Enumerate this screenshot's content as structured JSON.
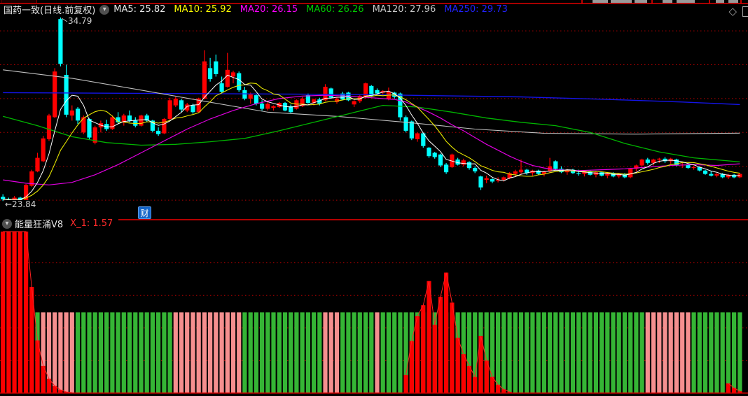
{
  "header": {
    "title": "国药一致(日线.前复权)",
    "ma_values": [
      {
        "name": "MA5",
        "label": "MA5: 25.82",
        "color": "#e8e8e8"
      },
      {
        "name": "MA10",
        "label": "MA10: 25.92",
        "color": "#ffff00"
      },
      {
        "name": "MA20",
        "label": "MA20: 26.15",
        "color": "#ff00ff"
      },
      {
        "name": "MA60",
        "label": "MA60: 26.26",
        "color": "#00c800"
      },
      {
        "name": "MA120",
        "label": "MA120: 27.96",
        "color": "#c8c8c8"
      },
      {
        "name": "MA250",
        "label": "MA250: 29.73",
        "color": "#2222ff"
      }
    ]
  },
  "price_panel": {
    "high_label": "34.79",
    "low_label": "←23.84",
    "event_marker": "财"
  },
  "indicator_panel": {
    "title": "能量狂涌V8",
    "value_label": "X_1: 1.57"
  },
  "colors": {
    "up": "#ff0000",
    "down": "#00ffff",
    "band_green": "#35b535",
    "band_pink": "#f58f8f",
    "bar_red": "#fa0000",
    "grid": "#b40000",
    "baseline": "#d40000",
    "ma5": "#ffffff",
    "ma10": "#e6e600",
    "ma20": "#e000e0",
    "ma60": "#00b400",
    "ma120": "#c0c0c0",
    "ma250": "#1414e6"
  },
  "chart_data": [
    {
      "type": "candlestick",
      "title": "国药一致 daily (front-adjusted)",
      "ylim": [
        23.3,
        35.1
      ],
      "grid_prices": [
        24,
        26,
        28,
        30,
        32,
        34
      ],
      "high_annotation": 34.79,
      "low_annotation": 23.84,
      "ohlc": [
        [
          24.2,
          24.35,
          23.95,
          24.05
        ],
        [
          24.05,
          24.15,
          23.84,
          23.95
        ],
        [
          23.95,
          24.25,
          23.88,
          24.15
        ],
        [
          24.15,
          24.2,
          23.85,
          23.95
        ],
        [
          23.95,
          24.95,
          23.9,
          24.9
        ],
        [
          24.85,
          25.8,
          24.8,
          25.7
        ],
        [
          25.7,
          26.8,
          25.65,
          26.5
        ],
        [
          26.3,
          27.8,
          26.25,
          27.65
        ],
        [
          27.6,
          29.1,
          27.5,
          29.0
        ],
        [
          28.9,
          31.8,
          28.85,
          31.6
        ],
        [
          34.7,
          34.79,
          31.9,
          32.05
        ],
        [
          31.4,
          32.0,
          28.9,
          29.05
        ],
        [
          29.0,
          29.6,
          28.7,
          29.3
        ],
        [
          29.4,
          29.5,
          28.5,
          28.7
        ],
        [
          28.0,
          29.0,
          27.9,
          28.9
        ],
        [
          28.8,
          28.85,
          27.6,
          27.7
        ],
        [
          27.4,
          28.4,
          27.3,
          28.3
        ],
        [
          28.3,
          28.7,
          28.0,
          28.55
        ],
        [
          28.5,
          28.75,
          28.1,
          28.2
        ],
        [
          28.2,
          29.0,
          28.15,
          28.9
        ],
        [
          28.9,
          29.2,
          28.5,
          28.6
        ],
        [
          28.6,
          29.1,
          28.4,
          29.0
        ],
        [
          29.0,
          29.3,
          28.6,
          28.7
        ],
        [
          28.7,
          28.9,
          28.3,
          28.4
        ],
        [
          28.4,
          29.05,
          28.35,
          29.0
        ],
        [
          29.0,
          29.1,
          28.6,
          28.7
        ],
        [
          28.7,
          28.75,
          28.0,
          28.1
        ],
        [
          28.1,
          28.3,
          27.8,
          27.9
        ],
        [
          27.95,
          28.85,
          27.9,
          28.8
        ],
        [
          28.8,
          30.05,
          28.75,
          29.9
        ],
        [
          29.6,
          30.1,
          29.5,
          30.0
        ],
        [
          29.9,
          30.0,
          29.2,
          29.35
        ],
        [
          29.3,
          29.75,
          29.2,
          29.65
        ],
        [
          29.6,
          29.7,
          29.1,
          29.2
        ],
        [
          29.2,
          30.05,
          29.15,
          30.0
        ],
        [
          30.0,
          32.85,
          29.95,
          32.2
        ],
        [
          31.8,
          32.4,
          31.0,
          31.15
        ],
        [
          32.2,
          32.6,
          31.3,
          31.45
        ],
        [
          30.9,
          31.3,
          30.3,
          30.4
        ],
        [
          30.7,
          32.7,
          30.65,
          31.7
        ],
        [
          31.3,
          31.65,
          30.9,
          31.55
        ],
        [
          31.5,
          31.6,
          30.4,
          30.5
        ],
        [
          30.5,
          30.7,
          29.9,
          30.0
        ],
        [
          30.0,
          30.35,
          29.7,
          30.25
        ],
        [
          30.2,
          30.3,
          29.6,
          29.7
        ],
        [
          29.7,
          29.9,
          29.3,
          29.4
        ],
        [
          29.4,
          29.8,
          29.3,
          29.7
        ],
        [
          29.45,
          29.6,
          29.3,
          29.55
        ],
        [
          29.5,
          29.8,
          29.45,
          29.75
        ],
        [
          29.75,
          29.8,
          29.25,
          29.3
        ],
        [
          29.55,
          29.65,
          29.15,
          29.2
        ],
        [
          29.4,
          29.95,
          29.35,
          29.9
        ],
        [
          29.55,
          30.1,
          29.5,
          30.0
        ],
        [
          30.2,
          30.3,
          29.7,
          29.75
        ],
        [
          29.75,
          30.0,
          29.6,
          29.95
        ],
        [
          29.95,
          30.05,
          29.6,
          29.7
        ],
        [
          29.9,
          30.85,
          29.85,
          30.7
        ],
        [
          30.6,
          30.65,
          30.0,
          30.05
        ],
        [
          29.8,
          30.1,
          29.7,
          30.0
        ],
        [
          30.3,
          30.4,
          29.9,
          29.95
        ],
        [
          30.35,
          30.4,
          29.85,
          29.9
        ],
        [
          29.65,
          29.9,
          29.5,
          29.85
        ],
        [
          29.85,
          30.2,
          29.75,
          30.15
        ],
        [
          30.1,
          30.95,
          30.0,
          30.9
        ],
        [
          30.75,
          30.8,
          30.1,
          30.15
        ],
        [
          30.5,
          30.6,
          30.2,
          30.3
        ],
        [
          30.35,
          30.5,
          30.2,
          30.45
        ],
        [
          29.95,
          30.65,
          29.9,
          30.4
        ],
        [
          30.35,
          30.4,
          30.0,
          30.1
        ],
        [
          30.3,
          30.35,
          28.7,
          28.9
        ],
        [
          28.9,
          29.0,
          28.0,
          28.1
        ],
        [
          28.65,
          28.7,
          27.55,
          27.65
        ],
        [
          27.6,
          28.0,
          27.45,
          27.95
        ],
        [
          27.95,
          28.0,
          27.1,
          27.2
        ],
        [
          27.1,
          27.15,
          26.5,
          26.6
        ],
        [
          26.8,
          26.85,
          26.45,
          26.55
        ],
        [
          26.7,
          26.75,
          25.95,
          26.05
        ],
        [
          26.1,
          26.2,
          25.55,
          25.65
        ],
        [
          25.95,
          26.75,
          25.9,
          26.7
        ],
        [
          26.4,
          26.5,
          26.05,
          26.1
        ],
        [
          26.1,
          26.45,
          26.0,
          26.35
        ],
        [
          26.25,
          26.3,
          25.8,
          25.9
        ],
        [
          25.9,
          26.0,
          25.6,
          25.7
        ],
        [
          25.4,
          25.45,
          24.6,
          24.75
        ],
        [
          25.2,
          25.45,
          25.0,
          25.3
        ],
        [
          25.25,
          25.3,
          25.0,
          25.1
        ],
        [
          25.15,
          25.35,
          25.05,
          25.2
        ],
        [
          25.2,
          25.4,
          25.1,
          25.35
        ],
        [
          25.3,
          25.65,
          25.25,
          25.6
        ],
        [
          25.55,
          25.8,
          25.4,
          25.7
        ],
        [
          25.65,
          26.4,
          25.55,
          25.8
        ],
        [
          25.8,
          25.85,
          25.5,
          25.6
        ],
        [
          25.6,
          25.8,
          25.45,
          25.75
        ],
        [
          25.75,
          25.8,
          25.5,
          25.55
        ],
        [
          25.55,
          25.75,
          25.4,
          25.7
        ],
        [
          25.7,
          26.5,
          25.6,
          26.0
        ],
        [
          26.3,
          26.35,
          25.8,
          25.85
        ],
        [
          25.85,
          26.0,
          25.6,
          25.65
        ],
        [
          25.65,
          25.85,
          25.5,
          25.8
        ],
        [
          25.8,
          25.85,
          25.55,
          25.6
        ],
        [
          25.6,
          25.8,
          25.45,
          25.55
        ],
        [
          25.55,
          25.75,
          25.4,
          25.7
        ],
        [
          25.7,
          25.75,
          25.45,
          25.5
        ],
        [
          25.5,
          25.7,
          25.35,
          25.65
        ],
        [
          25.65,
          25.7,
          25.4,
          25.45
        ],
        [
          25.45,
          25.65,
          25.3,
          25.6
        ],
        [
          25.6,
          25.65,
          25.35,
          25.4
        ],
        [
          25.4,
          25.6,
          25.3,
          25.55
        ],
        [
          25.55,
          25.6,
          25.3,
          25.35
        ],
        [
          25.35,
          25.9,
          25.3,
          25.85
        ],
        [
          25.85,
          26.1,
          25.7,
          26.05
        ],
        [
          26.05,
          26.45,
          26.0,
          26.4
        ],
        [
          26.4,
          26.5,
          26.1,
          26.2
        ],
        [
          26.2,
          26.45,
          26.05,
          26.4
        ],
        [
          26.4,
          26.5,
          26.2,
          26.45
        ],
        [
          26.45,
          26.55,
          26.2,
          26.3
        ],
        [
          26.3,
          26.5,
          26.15,
          26.45
        ],
        [
          26.4,
          26.45,
          26.0,
          26.05
        ],
        [
          26.05,
          26.2,
          25.9,
          26.1
        ],
        [
          26.1,
          26.15,
          25.85,
          25.9
        ],
        [
          25.9,
          26.05,
          25.8,
          25.95
        ],
        [
          25.95,
          26.0,
          25.7,
          25.75
        ],
        [
          25.75,
          25.8,
          25.5,
          25.55
        ],
        [
          25.55,
          25.7,
          25.4,
          25.45
        ],
        [
          25.45,
          25.6,
          25.35,
          25.55
        ],
        [
          25.55,
          25.6,
          25.3,
          25.35
        ],
        [
          25.35,
          25.55,
          25.25,
          25.5
        ],
        [
          25.5,
          25.55,
          25.3,
          25.35
        ],
        [
          25.35,
          25.6,
          25.3,
          25.55
        ]
      ],
      "ma_computed": [
        {
          "name": "MA5",
          "period": 5
        },
        {
          "name": "MA10",
          "period": 10
        }
      ],
      "ma_points": {
        "MA20": [
          [
            0,
            25.2
          ],
          [
            4,
            25.0
          ],
          [
            8,
            24.9
          ],
          [
            12,
            25.05
          ],
          [
            16,
            25.5
          ],
          [
            20,
            26.1
          ],
          [
            24,
            26.8
          ],
          [
            28,
            27.5
          ],
          [
            32,
            28.2
          ],
          [
            36,
            28.8
          ],
          [
            40,
            29.3
          ],
          [
            44,
            29.7
          ],
          [
            48,
            30.0
          ],
          [
            52,
            30.15
          ],
          [
            56,
            30.2
          ],
          [
            60,
            30.15
          ],
          [
            64,
            30.05
          ],
          [
            68,
            29.95
          ],
          [
            70,
            29.8
          ],
          [
            72,
            29.5
          ],
          [
            74,
            29.2
          ],
          [
            76,
            28.85
          ],
          [
            78,
            28.45
          ],
          [
            80,
            28.1
          ],
          [
            82,
            27.7
          ],
          [
            84,
            27.3
          ],
          [
            86,
            26.95
          ],
          [
            88,
            26.6
          ],
          [
            90,
            26.3
          ],
          [
            92,
            26.05
          ],
          [
            94,
            25.9
          ],
          [
            96,
            25.8
          ],
          [
            100,
            25.75
          ],
          [
            104,
            25.8
          ],
          [
            108,
            25.85
          ],
          [
            112,
            25.95
          ],
          [
            116,
            26.05
          ],
          [
            120,
            26.1
          ],
          [
            124,
            26.05
          ],
          [
            128,
            26.15
          ]
        ],
        "MA60": [
          [
            0,
            28.95
          ],
          [
            6,
            28.4
          ],
          [
            12,
            27.75
          ],
          [
            18,
            27.4
          ],
          [
            24,
            27.25
          ],
          [
            30,
            27.3
          ],
          [
            36,
            27.45
          ],
          [
            42,
            27.65
          ],
          [
            48,
            28.1
          ],
          [
            54,
            28.6
          ],
          [
            60,
            29.1
          ],
          [
            66,
            29.6
          ],
          [
            72,
            29.5
          ],
          [
            78,
            29.2
          ],
          [
            84,
            28.85
          ],
          [
            90,
            28.6
          ],
          [
            96,
            28.4
          ],
          [
            102,
            28.0
          ],
          [
            108,
            27.35
          ],
          [
            114,
            26.85
          ],
          [
            120,
            26.5
          ],
          [
            128,
            26.26
          ]
        ],
        "MA120": [
          [
            0,
            31.7
          ],
          [
            12,
            31.2
          ],
          [
            24,
            30.5
          ],
          [
            34,
            29.9
          ],
          [
            46,
            29.2
          ],
          [
            58,
            28.95
          ],
          [
            70,
            28.6
          ],
          [
            82,
            28.2
          ],
          [
            94,
            27.95
          ],
          [
            110,
            27.9
          ],
          [
            128,
            27.96
          ]
        ],
        "MA250": [
          [
            0,
            30.35
          ],
          [
            30,
            30.3
          ],
          [
            60,
            30.25
          ],
          [
            90,
            30.1
          ],
          [
            105,
            29.95
          ],
          [
            118,
            29.8
          ],
          [
            128,
            29.65
          ]
        ]
      }
    },
    {
      "type": "bar",
      "title": "能量狂涌V8",
      "last_value": 1.57,
      "ylim": [
        0,
        2.5
      ],
      "grid_values": [
        0.5,
        1.0,
        1.5,
        2.0
      ],
      "band_top": 1.24,
      "n_bars": 129,
      "band_segments": [
        {
          "from": 6,
          "to": 6,
          "color": "green"
        },
        {
          "from": 7,
          "to": 12,
          "color": "pink"
        },
        {
          "from": 13,
          "to": 29,
          "color": "green"
        },
        {
          "from": 30,
          "to": 41,
          "color": "pink"
        },
        {
          "from": 42,
          "to": 55,
          "color": "green"
        },
        {
          "from": 56,
          "to": 58,
          "color": "pink"
        },
        {
          "from": 59,
          "to": 64,
          "color": "green"
        },
        {
          "from": 65,
          "to": 65,
          "color": "pink"
        },
        {
          "from": 66,
          "to": 111,
          "color": "green"
        },
        {
          "from": 112,
          "to": 119,
          "color": "pink"
        },
        {
          "from": 120,
          "to": 128,
          "color": "green"
        }
      ],
      "red_runs": [
        {
          "start": 0,
          "values": [
            "full",
            "full",
            "full",
            "full",
            "full",
            1.63,
            0.81,
            0.42,
            0.22,
            0.11,
            0.05,
            0.02,
            0.01
          ]
        },
        {
          "start": 70,
          "values": [
            0.28,
            0.8,
            1.18,
            1.35,
            1.72,
            1.05,
            1.48,
            1.85,
            1.39,
            0.85,
            0.6,
            0.42,
            0.25,
            0.88,
            0.5,
            0.25,
            0.13,
            0.06,
            0.02
          ]
        },
        {
          "start": 126,
          "values": [
            0.15,
            0.08,
            0.03
          ]
        }
      ]
    }
  ]
}
